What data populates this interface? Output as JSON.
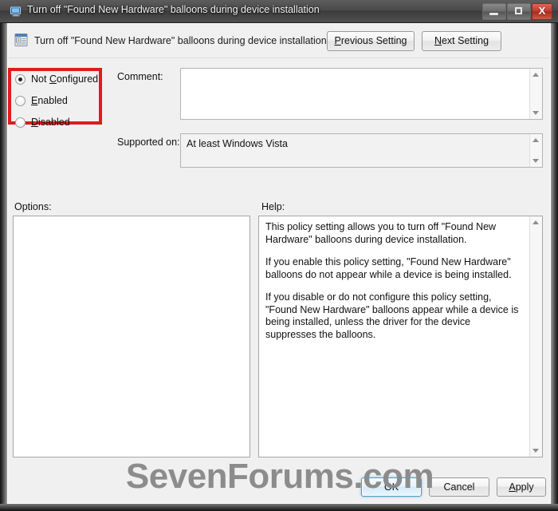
{
  "window": {
    "title": "Turn off \"Found New Hardware\" balloons during device installation",
    "title_icon": "monitor-icon",
    "minimize_label": "",
    "maximize_label": "",
    "close_label": "X"
  },
  "header": {
    "icon": "policy-document-icon",
    "title": "Turn off \"Found New Hardware\" balloons during device installation",
    "previous_setting": {
      "prefix": "",
      "accel": "P",
      "suffix": "revious Setting"
    },
    "next_setting": {
      "prefix": "",
      "accel": "N",
      "suffix": "ext Setting"
    }
  },
  "state_options": {
    "selected": "Not Configured",
    "items": [
      {
        "id": "not-configured",
        "prefix": "Not ",
        "accel": "C",
        "suffix": "onfigured",
        "checked": true
      },
      {
        "id": "enabled",
        "prefix": "",
        "accel": "E",
        "suffix": "nabled",
        "checked": false
      },
      {
        "id": "disabled",
        "prefix": "",
        "accel": "D",
        "suffix": "isabled",
        "checked": false
      }
    ],
    "highlight_color": "#e01b1b"
  },
  "comment": {
    "label": "Comment:",
    "value": "",
    "placeholder": ""
  },
  "supported_on": {
    "label": "Supported on:",
    "value": "At least Windows Vista"
  },
  "options": {
    "label": "Options:",
    "content": ""
  },
  "help": {
    "label": "Help:",
    "paragraphs": [
      "This policy setting allows you to turn off \"Found New Hardware\" balloons during device installation.",
      "If you enable this policy setting, \"Found New Hardware\" balloons do not appear while a device is being installed.",
      "If you disable or do not configure this policy setting, \"Found New Hardware\" balloons appear while a device is being installed, unless the driver for the device suppresses the balloons."
    ]
  },
  "footer": {
    "ok": "OK",
    "cancel": "Cancel",
    "apply": {
      "prefix": "",
      "accel": "A",
      "suffix": "pply"
    }
  },
  "watermark": {
    "text": "SevenForums.com"
  }
}
